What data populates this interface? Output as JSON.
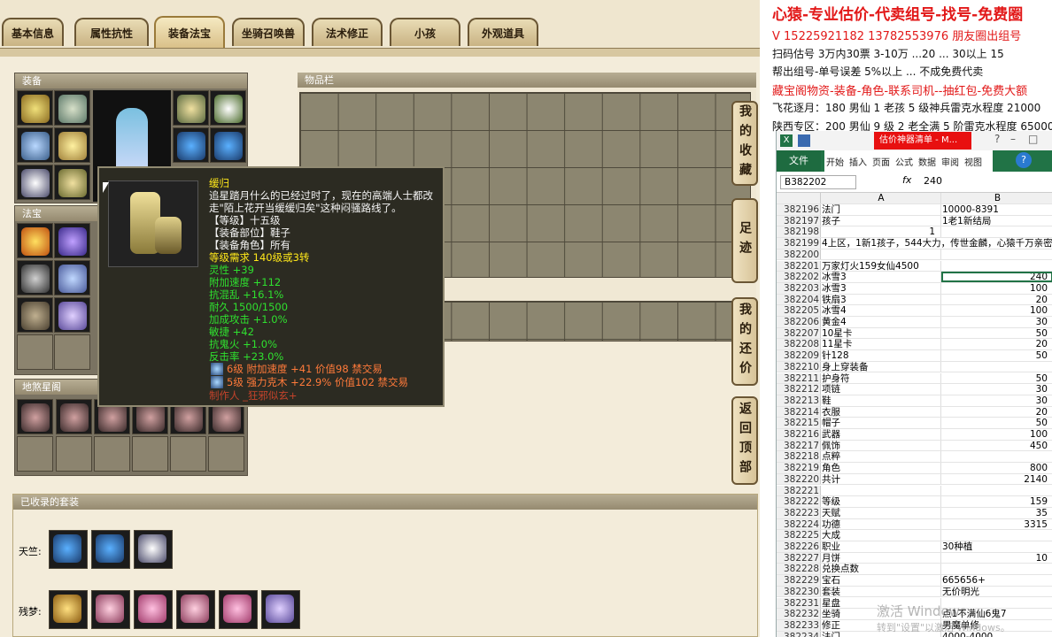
{
  "tabs": [
    {
      "label": "基本信息"
    },
    {
      "label": "属性抗性"
    },
    {
      "label": "装备法宝",
      "active": true
    },
    {
      "label": "坐骑召唤兽"
    },
    {
      "label": "法术修正"
    },
    {
      "label": "小孩"
    },
    {
      "label": "外观道具"
    }
  ],
  "panels": {
    "equip": "装备",
    "fabao": "法宝",
    "dishaxing": "地煞星阁",
    "items": "物品栏",
    "sets": "已收录的套装"
  },
  "side_buttons": [
    "我的收藏",
    "足迹",
    "我的还价",
    "返回顶部"
  ],
  "tooltip": {
    "name": "缓归",
    "desc1": "追星踏月什么的已经过时了，现在的高端人士都改",
    "desc2": "走\"陌上花开当缓缓归矣\"这种闷骚路线了。",
    "level": "【等级】十五级",
    "part": "【装备部位】鞋子",
    "role": "【装备角色】所有",
    "req": "等级需求 140级或3转",
    "ling": "灵性 +39",
    "speed": "附加速度 +112",
    "kanghun": "抗混乱 +16.1%",
    "naijiu": "耐久 1500/1500",
    "jiacheng": "加成攻击 +1.0%",
    "minjie": "敏捷 +42",
    "kanggui": "抗鬼火 +1.0%",
    "fanji": "反击率 +23.0%",
    "gem1": "6级 附加速度 +41 价值98 禁交易",
    "gem2": "5级 强力克木 +22.9% 价值102 禁交易",
    "maker": "制作人 _狂邪似玄+"
  },
  "sets": {
    "tianzhu": "天竺:",
    "canmeng": "残梦:"
  },
  "ads": {
    "line1": "心猿-专业估价-代卖组号-找号-免费圈",
    "line2": "V 15225921182   13782553976 朋友圈出组号",
    "line3": "扫码估号 3万内30票 3-10万 ...20 ... 30以上 15",
    "line4": "帮出组号-单号误差 5%以上 ... 不成免费代卖",
    "line5": "藏宝阁物资-装备-角色-联系司机--抽红包-免费大额",
    "line6": "飞花逐月：180 男仙 1 老孩 5 级神兵雷克水程度 21000",
    "line7": "陕西专区：200 男仙 9 级 2 老全满 5 阶雷克水程度 65000"
  },
  "excel": {
    "title": "估价神器清单 - M...",
    "ribbon": [
      "文件",
      "开始",
      "插入",
      "页面",
      "公式",
      "数据",
      "审阅",
      "视图"
    ],
    "namebox": "B382202",
    "fx": "fx",
    "formula": "240",
    "col_a": "A",
    "col_b": "B",
    "rows": [
      {
        "n": "382196",
        "a": "法门",
        "b": "10000-8391"
      },
      {
        "n": "382197",
        "a": "孩子",
        "b": "1老1新结局"
      },
      {
        "n": "382198",
        "a": "1",
        "b": ""
      },
      {
        "n": "382199",
        "a": "4上区，1新1孩子，544大力，传世金麟，心猿千万亲密",
        "b": ""
      },
      {
        "n": "382200",
        "a": "",
        "b": ""
      },
      {
        "n": "382201",
        "a": "万家灯火159女仙4500",
        "b": ""
      },
      {
        "n": "382202",
        "a": "冰雪3",
        "b": "240"
      },
      {
        "n": "382203",
        "a": "冰雪3",
        "b": "100"
      },
      {
        "n": "382204",
        "a": "铁扇3",
        "b": "20"
      },
      {
        "n": "382205",
        "a": "冰雪4",
        "b": "100"
      },
      {
        "n": "382206",
        "a": "黄金4",
        "b": "30"
      },
      {
        "n": "382207",
        "a": "10星卡",
        "b": "50"
      },
      {
        "n": "382208",
        "a": "11星卡",
        "b": "20"
      },
      {
        "n": "382209",
        "a": "针128",
        "b": "50"
      },
      {
        "n": "382210",
        "a": "身上穿装备",
        "b": ""
      },
      {
        "n": "382211",
        "a": "护身符",
        "b": "50"
      },
      {
        "n": "382212",
        "a": "项链",
        "b": "30"
      },
      {
        "n": "382213",
        "a": "鞋",
        "b": "30"
      },
      {
        "n": "382214",
        "a": "衣服",
        "b": "20"
      },
      {
        "n": "382215",
        "a": "帽子",
        "b": "50"
      },
      {
        "n": "382216",
        "a": "武器",
        "b": "100"
      },
      {
        "n": "382217",
        "a": "佩饰",
        "b": "450"
      },
      {
        "n": "382218",
        "a": "点粹",
        "b": ""
      },
      {
        "n": "382219",
        "a": "角色",
        "b": "800"
      },
      {
        "n": "382220",
        "a": "共计",
        "b": "2140"
      },
      {
        "n": "382221",
        "a": "",
        "b": ""
      },
      {
        "n": "382222",
        "a": "等级",
        "b": "159"
      },
      {
        "n": "382223",
        "a": "天赋",
        "b": "35"
      },
      {
        "n": "382224",
        "a": "功德",
        "b": "3315"
      },
      {
        "n": "382225",
        "a": "大成",
        "b": ""
      },
      {
        "n": "382226",
        "a": "职业",
        "b": "30种植"
      },
      {
        "n": "382227",
        "a": "月饼",
        "b": "10"
      },
      {
        "n": "382228",
        "a": "兑换点数",
        "b": ""
      },
      {
        "n": "382229",
        "a": "宝石",
        "b": "665656+"
      },
      {
        "n": "382230",
        "a": "套装",
        "b": "无价明光"
      },
      {
        "n": "382231",
        "a": "星盘",
        "b": ""
      },
      {
        "n": "382232",
        "a": "坐骑",
        "b": "点1不满仙6鬼7"
      },
      {
        "n": "382233",
        "a": "修正",
        "b": "男魔单修"
      },
      {
        "n": "382234",
        "a": "法门",
        "b": "4000-4000"
      }
    ]
  },
  "watermark": {
    "line1": "激活 Windows",
    "line2": "转到\"设置\"以激活 Windows。"
  }
}
